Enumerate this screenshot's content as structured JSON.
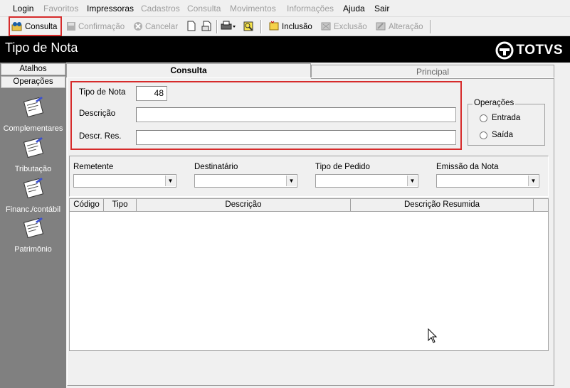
{
  "menu": {
    "items": [
      {
        "label": "Login",
        "enabled": true
      },
      {
        "label": "Favoritos",
        "enabled": false
      },
      {
        "label": "Impressoras",
        "enabled": true
      },
      {
        "label": "Cadastros",
        "enabled": false
      },
      {
        "label": "Consulta",
        "enabled": false
      },
      {
        "label": "Movimentos",
        "enabled": false
      },
      {
        "label": "Informações",
        "enabled": false
      },
      {
        "label": "Ajuda",
        "enabled": true
      },
      {
        "label": "Sair",
        "enabled": true
      }
    ]
  },
  "toolbar": {
    "consulta": "Consulta",
    "confirmacao": "Confirmação",
    "cancelar": "Cancelar",
    "inclusao": "Inclusão",
    "exclusao": "Exclusão",
    "alteracao": "Alteração"
  },
  "window": {
    "title": "Tipo de Nota",
    "logo_text": "TOTVS"
  },
  "sidebar": {
    "header": "Atalhos",
    "section": "Operações",
    "items": [
      {
        "label": "Complementares",
        "icon": "document-pen-icon"
      },
      {
        "label": "Tributação",
        "icon": "document-pen-icon"
      },
      {
        "label": "Financ./contábil",
        "icon": "document-pen-icon"
      },
      {
        "label": "Patrimônio",
        "icon": "document-pen-icon"
      }
    ]
  },
  "tabs": {
    "active": "Consulta",
    "inactive": "Principal"
  },
  "form": {
    "tipo_label": "Tipo de Nota",
    "tipo_value": "48",
    "descricao_label": "Descrição",
    "descricao_value": "",
    "descr_res_label": "Descr. Res.",
    "descr_res_value": ""
  },
  "operacoes": {
    "title": "Operações",
    "options": [
      "Entrada",
      "Saída"
    ]
  },
  "filters": {
    "remetente": "Remetente",
    "destinatario": "Destinatário",
    "tipo_pedido": "Tipo de Pedido",
    "emissao": "Emissão da Nota"
  },
  "table": {
    "columns": [
      "Código",
      "Tipo",
      "Descrição",
      "Descrição Resumida"
    ],
    "rows": []
  },
  "colors": {
    "highlight": "#d62b2b",
    "titlebar": "#000000",
    "sidebar": "#808080"
  }
}
